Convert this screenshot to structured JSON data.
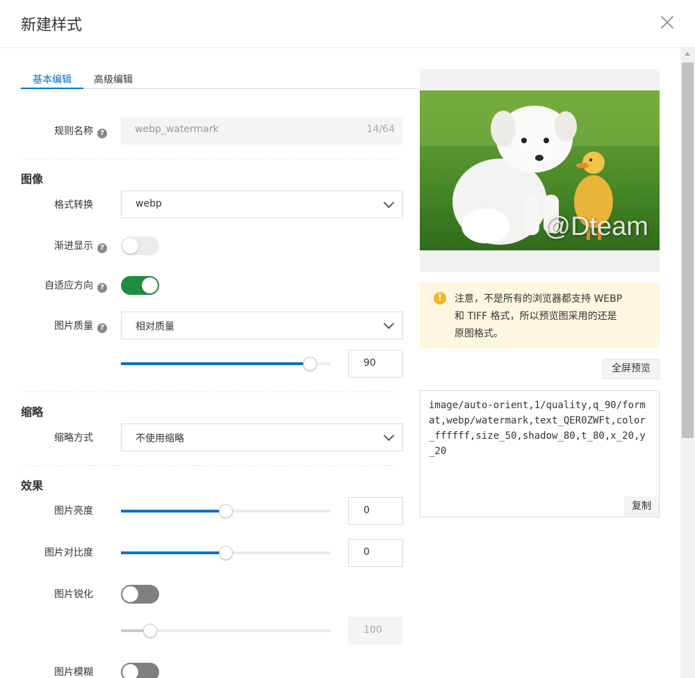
{
  "dialog": {
    "title": "新建样式"
  },
  "tabs": [
    {
      "label": "基本编辑"
    },
    {
      "label": "高级编辑"
    }
  ],
  "rule_name": {
    "label": "规则名称",
    "value": "webp_watermark",
    "counter": "14/64"
  },
  "sections": {
    "image": "图像",
    "thumbnail": "缩略",
    "effects": "效果"
  },
  "format": {
    "label": "格式转换",
    "value": "webp"
  },
  "progressive": {
    "label": "渐进显示",
    "on": false
  },
  "auto_orient": {
    "label": "自适应方向",
    "on": true
  },
  "quality": {
    "label": "图片质量",
    "mode": "相对质量",
    "value": "90",
    "slider_fraction": 0.9
  },
  "thumb_mode": {
    "label": "缩略方式",
    "value": "不使用缩略"
  },
  "brightness": {
    "label": "图片亮度",
    "value": "0",
    "slider_fraction": 0.5
  },
  "contrast": {
    "label": "图片对比度",
    "value": "0",
    "slider_fraction": 0.5
  },
  "sharpen": {
    "label": "图片锐化",
    "on": false,
    "value": "100",
    "slider_fraction": 0.14
  },
  "blur": {
    "label": "图片模糊",
    "on": false
  },
  "preview": {
    "watermark_text": "@Dteam"
  },
  "notice": {
    "icon": "warning-icon",
    "lines": [
      "注意，不是所有的浏览器都支持 WEBP",
      "和 TIFF 格式，所以预览图采用的还是",
      "原图格式。"
    ]
  },
  "fullscreen_button": "全屏预览",
  "style_code": "image/auto-orient,1/quality,q_90/format,webp/watermark,text_QER0ZWFt,color_ffffff,size_50,shadow_80,t_80,x_20,y_20",
  "copy_button": "复制",
  "colors": {
    "accent": "#0070cc",
    "toggle_on": "#1e8e3e",
    "notice_bg": "#fdf6e0"
  }
}
